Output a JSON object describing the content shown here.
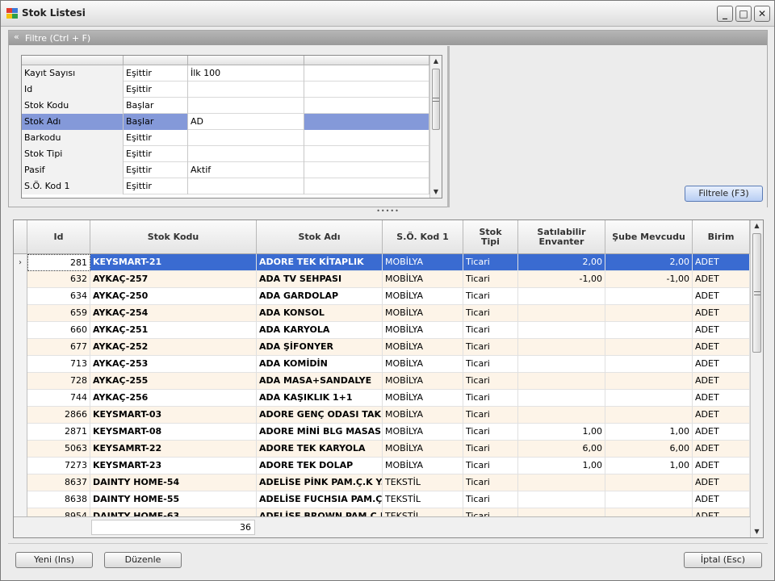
{
  "window": {
    "title": "Stok Listesi",
    "minimize": "_",
    "maximize": "□",
    "close": "✕"
  },
  "filter": {
    "header_label": "Filtre (Ctrl + F)",
    "rows": [
      {
        "field": "Kayıt Sayısı",
        "op": "Eşittir",
        "value": "İlk 100",
        "extra": ""
      },
      {
        "field": "Id",
        "op": "Eşittir",
        "value": "",
        "extra": ""
      },
      {
        "field": "Stok Kodu",
        "op": "Başlar",
        "value": "",
        "extra": ""
      },
      {
        "field": "Stok Adı",
        "op": "Başlar",
        "value": "AD",
        "extra": ""
      },
      {
        "field": "Barkodu",
        "op": "Eşittir",
        "value": "",
        "extra": ""
      },
      {
        "field": "Stok Tipi",
        "op": "Eşittir",
        "value": "",
        "extra": ""
      },
      {
        "field": "Pasif",
        "op": "Eşittir",
        "value": "Aktif",
        "extra": ""
      },
      {
        "field": "S.Ö. Kod 1",
        "op": "Eşittir",
        "value": "",
        "extra": ""
      }
    ],
    "apply_button": "Filtrele (F3)"
  },
  "grid": {
    "columns": {
      "id": "Id",
      "code": "Stok Kodu",
      "name": "Stok Adı",
      "so1": "S.Ö. Kod 1",
      "type_l1": "Stok",
      "type_l2": "Tipi",
      "inv_l1": "Satılabilir",
      "inv_l2": "Envanter",
      "branch": "Şube Mevcudu",
      "unit": "Birim"
    },
    "rows": [
      {
        "id": "281",
        "code": "KEYSMART-21",
        "name": "ADORE TEK KİTAPLIK",
        "so1": "MOBİLYA",
        "type": "Ticari",
        "inv": "2,00",
        "branch": "2,00",
        "unit": "ADET"
      },
      {
        "id": "632",
        "code": "AYKAÇ-257",
        "name": "ADA TV SEHPASI",
        "so1": "MOBİLYA",
        "type": "Ticari",
        "inv": "-1,00",
        "branch": "-1,00",
        "unit": "ADET"
      },
      {
        "id": "634",
        "code": "AYKAÇ-250",
        "name": "ADA GARDOLAP",
        "so1": "MOBİLYA",
        "type": "Ticari",
        "inv": "",
        "branch": "",
        "unit": "ADET"
      },
      {
        "id": "659",
        "code": "AYKAÇ-254",
        "name": "ADA KONSOL",
        "so1": "MOBİLYA",
        "type": "Ticari",
        "inv": "",
        "branch": "",
        "unit": "ADET"
      },
      {
        "id": "660",
        "code": "AYKAÇ-251",
        "name": "ADA KARYOLA",
        "so1": "MOBİLYA",
        "type": "Ticari",
        "inv": "",
        "branch": "",
        "unit": "ADET"
      },
      {
        "id": "677",
        "code": "AYKAÇ-252",
        "name": "ADA ŞİFONYER",
        "so1": "MOBİLYA",
        "type": "Ticari",
        "inv": "",
        "branch": "",
        "unit": "ADET"
      },
      {
        "id": "713",
        "code": "AYKAÇ-253",
        "name": "ADA KOMİDİN",
        "so1": "MOBİLYA",
        "type": "Ticari",
        "inv": "",
        "branch": "",
        "unit": "ADET"
      },
      {
        "id": "728",
        "code": "AYKAÇ-255",
        "name": "ADA MASA+SANDALYE",
        "so1": "MOBİLYA",
        "type": "Ticari",
        "inv": "",
        "branch": "",
        "unit": "ADET"
      },
      {
        "id": "744",
        "code": "AYKAÇ-256",
        "name": "ADA KAŞIKLIK 1+1",
        "so1": "MOBİLYA",
        "type": "Ticari",
        "inv": "",
        "branch": "",
        "unit": "ADET"
      },
      {
        "id": "2866",
        "code": "KEYSMART-03",
        "name": "ADORE GENÇ ODASI TAKI...",
        "so1": "MOBİLYA",
        "type": "Ticari",
        "inv": "",
        "branch": "",
        "unit": "ADET"
      },
      {
        "id": "2871",
        "code": "KEYSMART-08",
        "name": "ADORE MİNİ BLG MASASI",
        "so1": "MOBİLYA",
        "type": "Ticari",
        "inv": "1,00",
        "branch": "1,00",
        "unit": "ADET"
      },
      {
        "id": "5063",
        "code": "KEYSAMRT-22",
        "name": "ADORE TEK KARYOLA",
        "so1": "MOBİLYA",
        "type": "Ticari",
        "inv": "6,00",
        "branch": "6,00",
        "unit": "ADET"
      },
      {
        "id": "7273",
        "code": "KEYSMART-23",
        "name": "ADORE TEK DOLAP",
        "so1": "MOBİLYA",
        "type": "Ticari",
        "inv": "1,00",
        "branch": "1,00",
        "unit": "ADET"
      },
      {
        "id": "8637",
        "code": "DAINTY HOME-54",
        "name": "ADELİSE PİNK PAM.Ç.K Y.Ö",
        "so1": "TEKSTİL",
        "type": "Ticari",
        "inv": "",
        "branch": "",
        "unit": "ADET"
      },
      {
        "id": "8638",
        "code": "DAINTY HOME-55",
        "name": "ADELİSE FUCHSIA PAM.Ç....",
        "so1": "TEKSTİL",
        "type": "Ticari",
        "inv": "",
        "branch": "",
        "unit": "ADET"
      },
      {
        "id": "8954",
        "code": "DAINTY HOME-63",
        "name": "ADELİSE BROWN PAM.Ç.K...",
        "so1": "TEKSTİL",
        "type": "Ticari",
        "inv": "",
        "branch": "",
        "unit": "ADET"
      }
    ],
    "selected_indicator": "›",
    "footer_count": "36"
  },
  "buttons": {
    "new": "Yeni (Ins)",
    "edit": "Düzenle",
    "cancel": "İptal (Esc)"
  },
  "colors": {
    "selection": "#3a6bd1",
    "filter_selection": "#8499d9",
    "alt_row": "#fdf4e8"
  }
}
